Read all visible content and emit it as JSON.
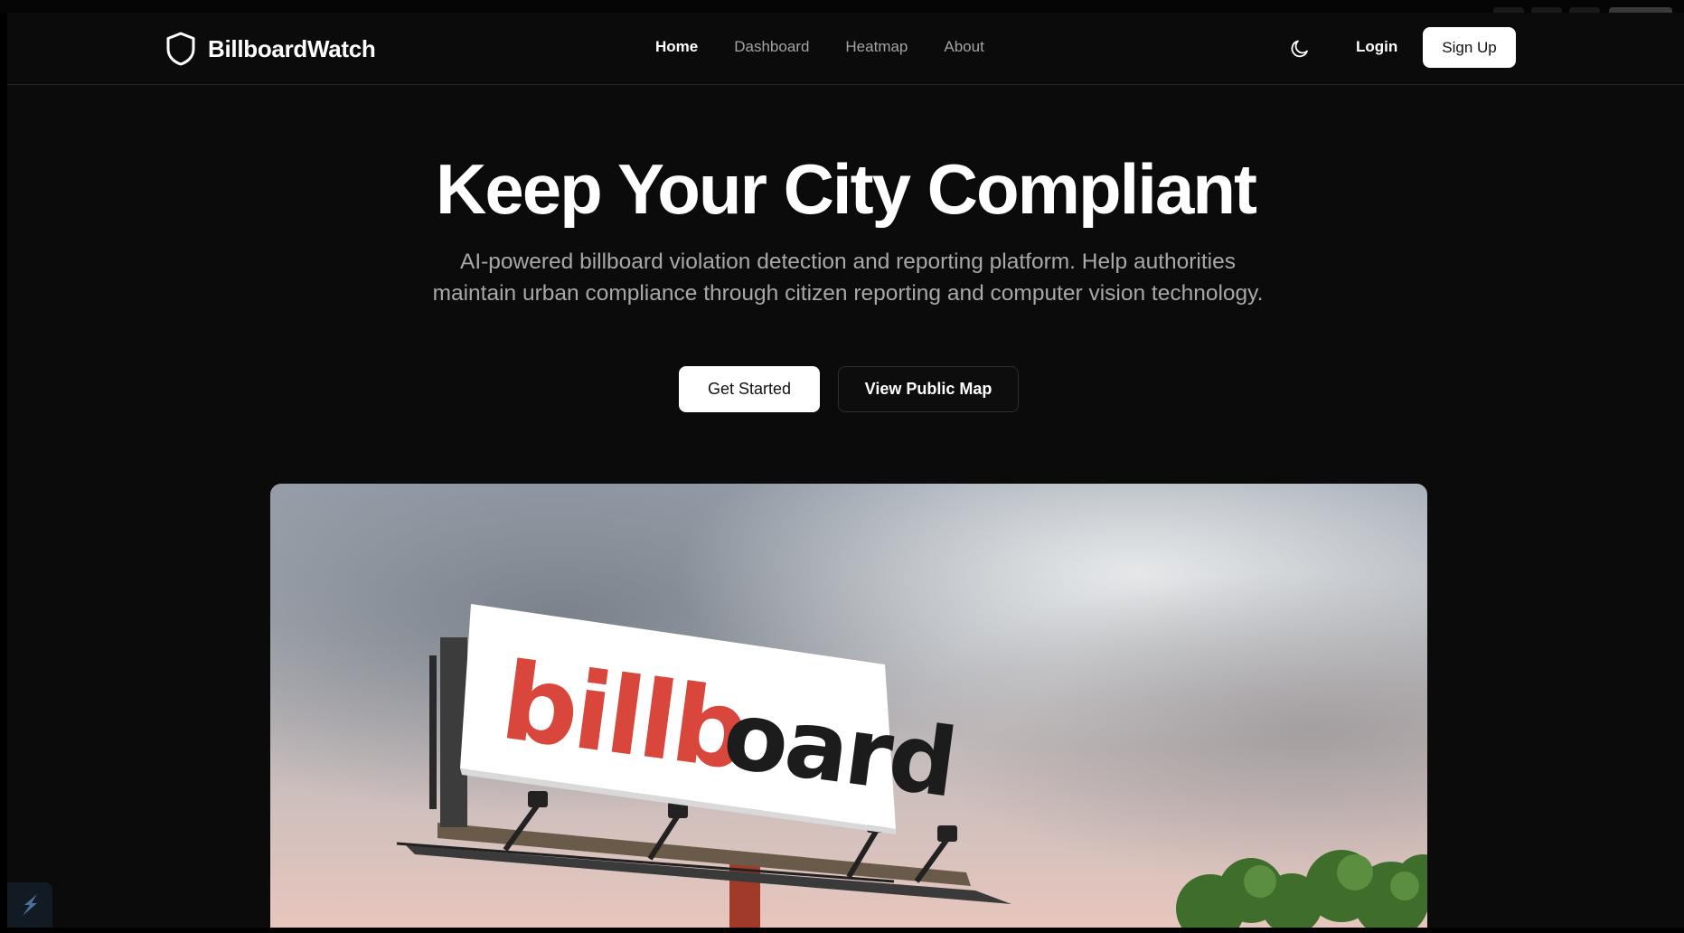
{
  "brand": {
    "name": "BillboardWatch",
    "icon": "shield-icon"
  },
  "nav": {
    "links": [
      {
        "label": "Home",
        "active": true
      },
      {
        "label": "Dashboard",
        "active": false
      },
      {
        "label": "Heatmap",
        "active": false
      },
      {
        "label": "About",
        "active": false
      }
    ],
    "theme_icon": "moon-icon",
    "login_label": "Login",
    "signup_label": "Sign Up"
  },
  "hero": {
    "title": "Keep Your City Compliant",
    "subtitle": "AI-powered billboard violation detection and reporting platform. Help authorities maintain urban compliance through citizen reporting and computer vision technology.",
    "primary_cta": "Get Started",
    "secondary_cta": "View Public Map",
    "image": {
      "billboard_text_red": "billb",
      "billboard_text_dark": "oard"
    }
  },
  "colors": {
    "page_bg": "#0b0b0b",
    "text_primary": "#ffffff",
    "text_muted": "#a3a3a3",
    "billboard_red": "#d9463b",
    "billboard_dark": "#1c1c1c"
  }
}
